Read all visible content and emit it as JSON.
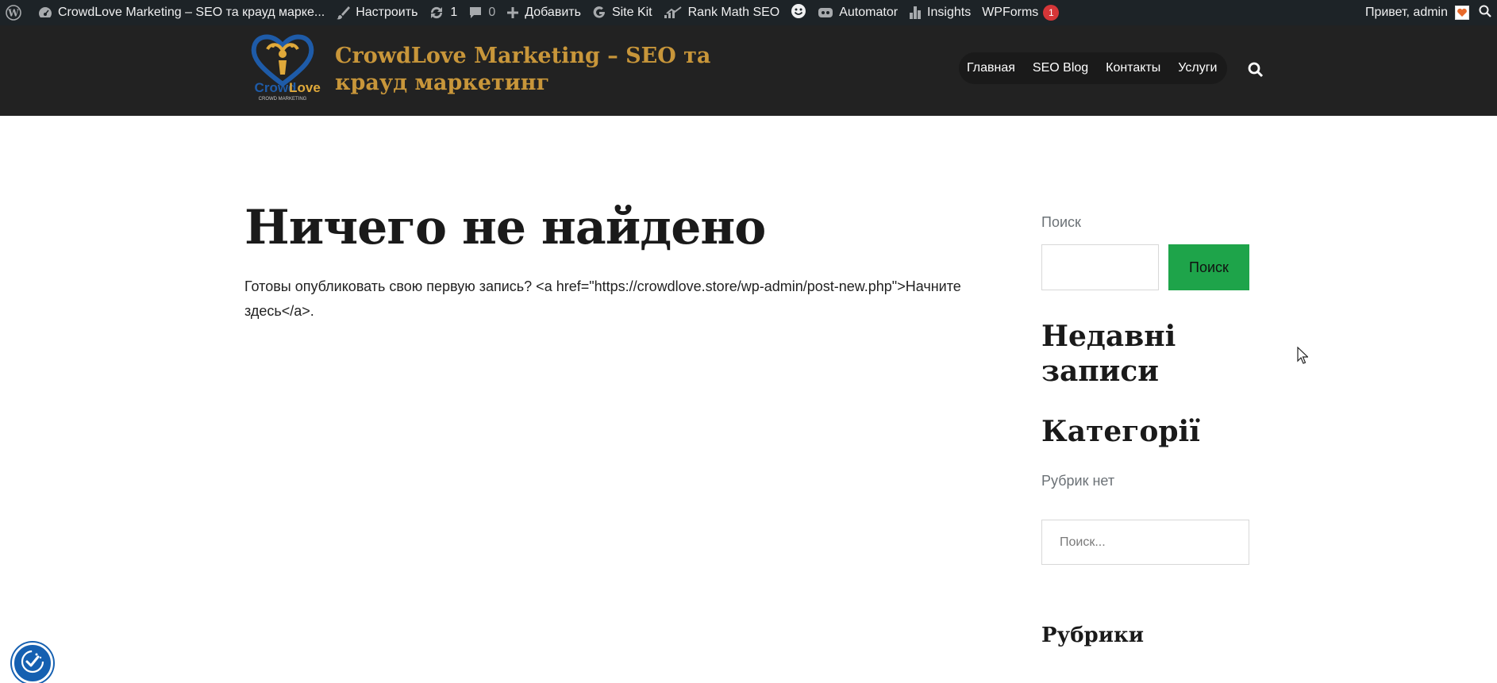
{
  "adminbar": {
    "wp_logo_icon": "wordpress-icon",
    "site_name": "CrowdLove Marketing – SEO та крауд марке...",
    "customize": "Настроить",
    "updates_count": "1",
    "comments_count": "0",
    "new_label": "Добавить",
    "sitekit": "Site Kit",
    "rankmath": "Rank Math SEO",
    "automator": "Automator",
    "insights": "Insights",
    "wpforms": "WPForms",
    "wpforms_badge": "1",
    "greeting": "Привет, admin"
  },
  "header": {
    "logo_text": "CrowdLove",
    "logo_subtext": "CROWD MARKETING",
    "site_title": "CrowdLove Marketing – SEO та крауд маркетинг",
    "nav": [
      "Главная",
      "SEO Blog",
      "Контакты",
      "Услуги"
    ]
  },
  "main": {
    "title": "Ничего не найдено",
    "text": "Готовы опубликовать свою первую запись? <a href=\"https://crowdlove.store/wp-admin/post-new.php\">Начните здесь</a>."
  },
  "sidebar": {
    "search_label": "Поиск",
    "search_button": "Поиск",
    "recent_heading": "Недавні записи",
    "categories_heading": "Категорії",
    "no_categories": "Рубрик нет",
    "search2_placeholder": "Поиск...",
    "rubrics_heading": "Рубрики"
  },
  "colors": {
    "adminbar_bg": "#1d2327",
    "header_bg": "#222222",
    "brand_gold": "#c8963a",
    "search_button_green": "#1ea44a",
    "a11y_blue": "#1560b1"
  }
}
